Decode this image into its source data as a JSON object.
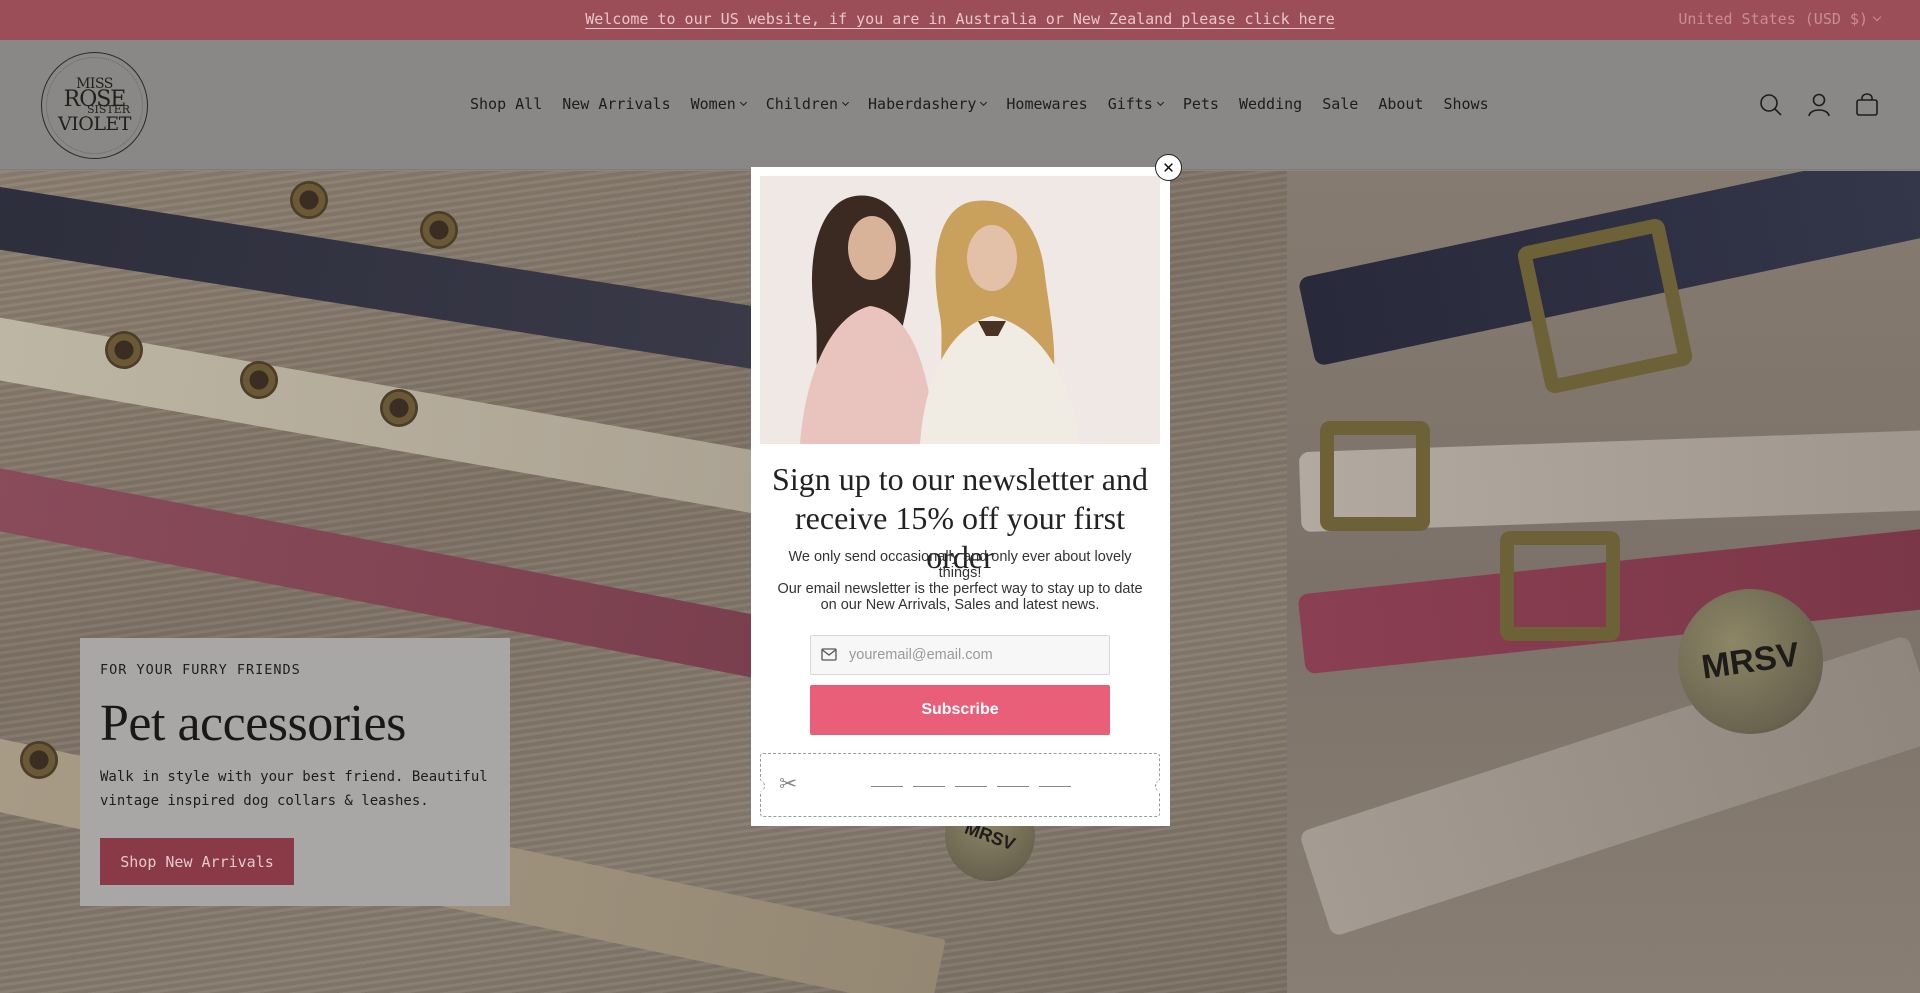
{
  "announcement": {
    "text": "Welcome to our US website, if you are in Australia or New Zealand please click here",
    "currency": "United States (USD $)"
  },
  "logo": {
    "line1": "MISS",
    "line2": "ROSE",
    "line3": "SISTER",
    "line4": "VIOLET"
  },
  "nav": {
    "items": [
      {
        "label": "Shop All",
        "dropdown": false
      },
      {
        "label": "New Arrivals",
        "dropdown": false
      },
      {
        "label": "Women",
        "dropdown": true
      },
      {
        "label": "Children",
        "dropdown": true
      },
      {
        "label": "Haberdashery",
        "dropdown": true
      },
      {
        "label": "Homewares",
        "dropdown": false
      },
      {
        "label": "Gifts",
        "dropdown": true
      },
      {
        "label": "Pets",
        "dropdown": false
      },
      {
        "label": "Wedding",
        "dropdown": false
      },
      {
        "label": "Sale",
        "dropdown": false
      },
      {
        "label": "About",
        "dropdown": false
      },
      {
        "label": "Shows",
        "dropdown": false
      }
    ]
  },
  "header_icons": [
    "search-icon",
    "account-icon",
    "cart-icon"
  ],
  "hero": {
    "eyebrow": "FOR YOUR FURRY FRIENDS",
    "title": "Pet accessories",
    "body": "Walk in style with your best friend. Beautiful vintage inspired dog collars & leashes.",
    "button": "Shop New Arrivals",
    "tag_text": "MRSV"
  },
  "popup": {
    "title": "Sign up to our newsletter and receive 15% off your first order",
    "text_line1": "We only send occasionally and only ever about lovely things!",
    "text_line2": "Our email newsletter is the perfect way to stay up to date on our New Arrivals, Sales and latest news.",
    "email_placeholder": "youremail@email.com",
    "subscribe_label": "Subscribe",
    "close_label": "✕"
  },
  "colors": {
    "announce_bg": "#9b4e57",
    "subscribe_bg": "#e95e78",
    "hero_button_bg": "#8a3a46"
  }
}
